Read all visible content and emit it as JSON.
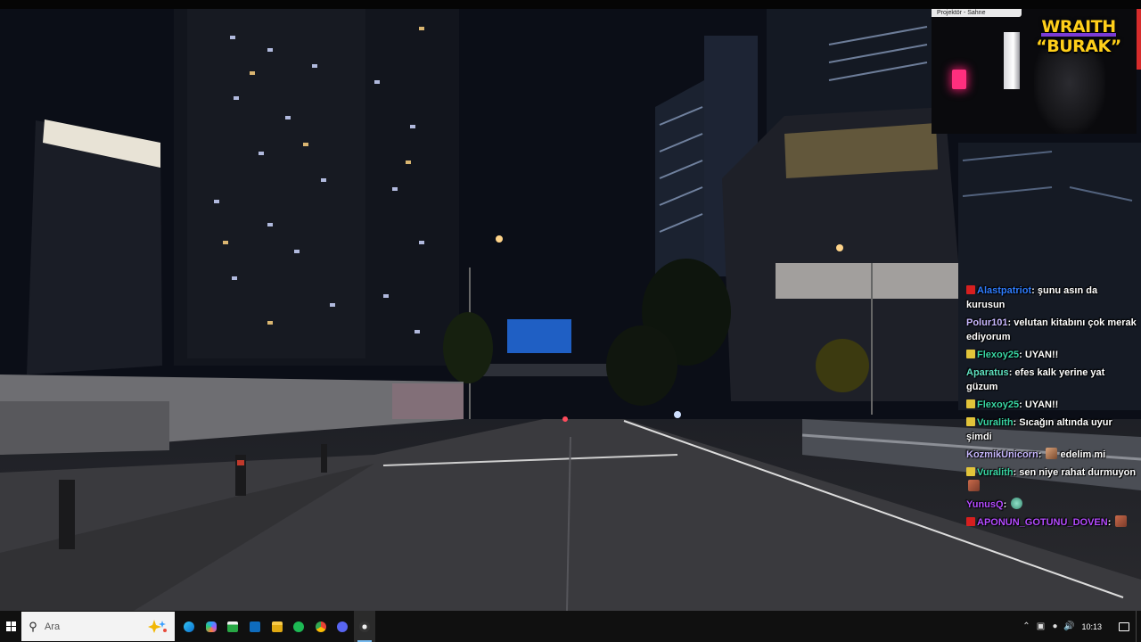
{
  "stream": {
    "webcam_tab": "Projektör - Sahne",
    "streamer_name_line1": "WRAITH",
    "streamer_name_line2": "“BURAK”",
    "accent_colors": {
      "name": "#ffcf1a",
      "underline": "#7a3bd6"
    }
  },
  "chat": {
    "messages": [
      {
        "user": "Alastpatriot",
        "color": "#2f7dff",
        "badge": "red",
        "text": " şunu asın da kurusun",
        "emote": ""
      },
      {
        "user": "Polur101",
        "color": "#c8b8ff",
        "badge": "",
        "text": " velutan kitabını çok merak ediyorum",
        "emote": ""
      },
      {
        "user": "Flexoy25",
        "color": "#39d6a4",
        "badge": "gold",
        "text": " UYAN!!",
        "emote": ""
      },
      {
        "user": "Aparatus",
        "color": "#5fe0c0",
        "badge": "",
        "text": " efes kalk yerine yat güzum",
        "emote": ""
      },
      {
        "user": "Flexoy25",
        "color": "#39d6a4",
        "badge": "gold",
        "text": " UYAN!!",
        "emote": ""
      },
      {
        "user": "Vuralith",
        "color": "#39d6a4",
        "badge": "gold",
        "text": " Sıcağın altında uyur şimdi",
        "emote": ""
      },
      {
        "user": "KozmikUnicorn",
        "color": "#c8b8ff",
        "badge": "",
        "text": " edelim mi",
        "emote_before": "face-emote"
      },
      {
        "user": "Vuralith",
        "color": "#39d6a4",
        "badge": "gold",
        "text": " sen niye rahat durmuyon",
        "emote": "cat-emote"
      },
      {
        "user": "YunusQ",
        "color": "#b44bff",
        "badge": "",
        "text": " ",
        "emote": "pepe-emote"
      },
      {
        "user": "APONUN_GOTUNU_DOVEN",
        "color": "#b44bff",
        "badge": "red",
        "text": " ",
        "emote": "cat-emote"
      }
    ]
  },
  "taskbar": {
    "search_placeholder": "Ara",
    "clock": "10:13",
    "pinned": [
      "edge-icon",
      "copilot-icon",
      "store-icon",
      "outlook-icon",
      "file-explorer-icon",
      "spotify-icon",
      "chrome-icon",
      "discord-icon",
      "obs-icon"
    ]
  }
}
